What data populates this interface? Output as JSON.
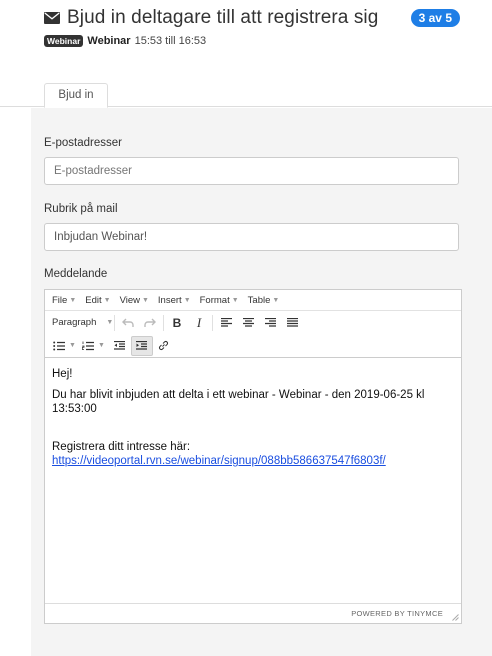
{
  "header": {
    "title": "Bjud in deltagare till att registrera sig",
    "step_badge": "3 av 5",
    "tag_badge": "Webinar",
    "subtitle_name": "Webinar",
    "subtitle_time": "15:53 till 16:53"
  },
  "tabs": [
    {
      "label": "Bjud in",
      "active": true
    }
  ],
  "form": {
    "email_label": "E-postadresser",
    "email_placeholder": "E-postadresser",
    "email_value": "",
    "subject_label": "Rubrik på mail",
    "subject_value": "Inbjudan Webinar!",
    "message_label": "Meddelande"
  },
  "editor": {
    "menu": [
      "File",
      "Edit",
      "View",
      "Insert",
      "Format",
      "Table"
    ],
    "block_format": "Paragraph",
    "content": {
      "greeting": "Hej!",
      "body": "Du har blivit inbjuden att delta i ett webinar - Webinar - den 2019-06-25 kl 13:53:00",
      "register_text": "Registrera ditt intresse här:",
      "register_link": "https://videoportal.rvn.se/webinar/signup/088bb586637547f6803f/"
    },
    "powered_by": "POWERED BY TINYMCE"
  },
  "icons": {
    "envelope": "envelope-icon",
    "undo": "undo-icon",
    "redo": "redo-icon",
    "bold": "bold-icon",
    "italic": "italic-icon",
    "align_left": "align-left-icon",
    "align_center": "align-center-icon",
    "align_right": "align-right-icon",
    "align_justify": "align-justify-icon",
    "bullet_list": "bullet-list-icon",
    "numbered_list": "numbered-list-icon",
    "outdent": "outdent-icon",
    "indent": "indent-icon",
    "link": "link-icon"
  },
  "colors": {
    "accent": "#1e7ee6",
    "link": "#1a4ee0",
    "panel_bg": "#f4f4f4"
  }
}
